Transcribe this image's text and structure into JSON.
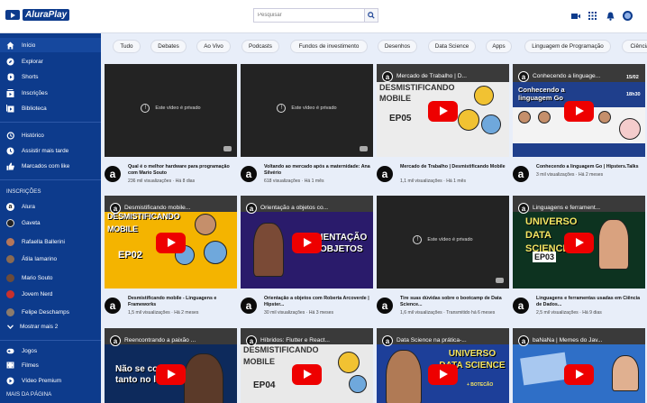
{
  "header": {
    "logo_text": "AluraPlay",
    "search_placeholder": "Pesquisar"
  },
  "sidebar": {
    "main": [
      {
        "label": "Início",
        "icon": "home-icon"
      },
      {
        "label": "Explorar",
        "icon": "compass-icon"
      },
      {
        "label": "Shorts",
        "icon": "shorts-icon"
      },
      {
        "label": "Inscrições",
        "icon": "subscriptions-icon"
      },
      {
        "label": "Biblioteca",
        "icon": "library-icon"
      }
    ],
    "secondary": [
      {
        "label": "Histórico",
        "icon": "history-icon"
      },
      {
        "label": "Assistir mais tarde",
        "icon": "clock-icon"
      },
      {
        "label": "Marcados com like",
        "icon": "thumbs-up-icon"
      }
    ],
    "subscriptions_heading": "INSCRIÇÕES",
    "subscriptions": [
      {
        "label": "Alura",
        "color": "#111111"
      },
      {
        "label": "Gaveta",
        "color": "#222222"
      },
      {
        "label": "Rafaella Ballerini",
        "color": "#b5765a"
      },
      {
        "label": "Átila Iamarino",
        "color": "#8a6a52"
      },
      {
        "label": "Mario Souto",
        "color": "#6b4b3b"
      },
      {
        "label": "Jovem Nerd",
        "color": "#c9302c"
      },
      {
        "label": "Felipe Deschamps",
        "color": "#8c7b6b"
      }
    ],
    "show_more": "Mostrar mais 2",
    "more": [
      {
        "label": "Jogos",
        "icon": "gamepad-icon"
      },
      {
        "label": "Filmes",
        "icon": "film-icon"
      },
      {
        "label": "Vídeo Premium",
        "icon": "premium-icon"
      }
    ],
    "more_heading": "MAIS DA PÁGINA"
  },
  "chips": [
    "Tudo",
    "Debates",
    "Ao Vivo",
    "Podcasts",
    "Fundos de investimento",
    "Desenhos",
    "Data Science",
    "Apps",
    "Linguagem de Programação",
    "Ciência"
  ],
  "private_text": "Este vídeo é privado",
  "videos": [
    {
      "title": "Qual é o melhor hardware para programação com Mario Souto",
      "meta": "236 mil visualizações · Há 8 dias",
      "private": true
    },
    {
      "title": "Voltando ao mercado após a maternidade: Ana Silvério",
      "meta": "618 visualizações · Há 1 mês",
      "private": true
    },
    {
      "title": "Mercado de Trabalho | Desmistificando Mobile",
      "meta": "1,1 mil visualizações · Há 1 mês",
      "thumb_title": "Mercado de Trabalho | D...",
      "thumb_big": "DESMISTIFICANDO MOBILE",
      "thumb_ep": "EP05"
    },
    {
      "title": "Conhecendo a linguagem Go | Hipsters.Talks",
      "meta": "3 mil visualizações · Há 2 meses",
      "thumb_title": "Conhecendo a linguage...",
      "thumb_big": "Conhecendo a linguagem Go",
      "thumb_date": "15/02",
      "thumb_time": "18h30"
    },
    {
      "title": "Desmistificando mobile - Linguagens e Frameworks",
      "meta": "1,5 mil visualizações · Há 2 meses",
      "thumb_title": "Desmistificando mobile...",
      "thumb_big": "DESMISTIFICANDO MOBILE",
      "thumb_ep": "EP02"
    },
    {
      "title": "Orientação a objetos com Roberta Arcoverde | Hipster...",
      "meta": "30 mil visualizações · Há 3 meses",
      "thumb_title": "Orientação a objetos co...",
      "thumb_big": "ORIENTAÇÃO A OBJETOS"
    },
    {
      "title": "Tire suas dúvidas sobre o bootcamp de Data Science...",
      "meta": "1,6 mil visualizações · Transmitido há 6 meses",
      "private": true
    },
    {
      "title": "Linguagens e ferramentas usadas em Ciência de Dados...",
      "meta": "2,5 mil visualizações · Há 9 dias",
      "thumb_title": "Linguagens e ferrament...",
      "thumb_big": "UNIVERSO DATA SCIENCE",
      "thumb_ep": "EP03"
    },
    {
      "title": "Reencontrando a paixão ...",
      "meta": "",
      "thumb_title": "Reencontrando a paixão ...",
      "thumb_big": "Não se co tanto no li"
    },
    {
      "title": "Híbridos: Flutter e React ...",
      "meta": "",
      "thumb_title": "Híbridos: Flutter e React...",
      "thumb_big": "DESMISTIFICANDO MOBILE",
      "thumb_ep": "EP04"
    },
    {
      "title": "Data Science na prática-...",
      "meta": "",
      "thumb_title": "Data Science na prática-...",
      "thumb_big": "UNIVERSO DATA SCIENCE",
      "thumb_extra": "+ BOTECÃO"
    },
    {
      "title": "baNaNa | Memes do Jav...",
      "meta": "",
      "thumb_title": "baNaNa | Memes do Jav..."
    }
  ]
}
